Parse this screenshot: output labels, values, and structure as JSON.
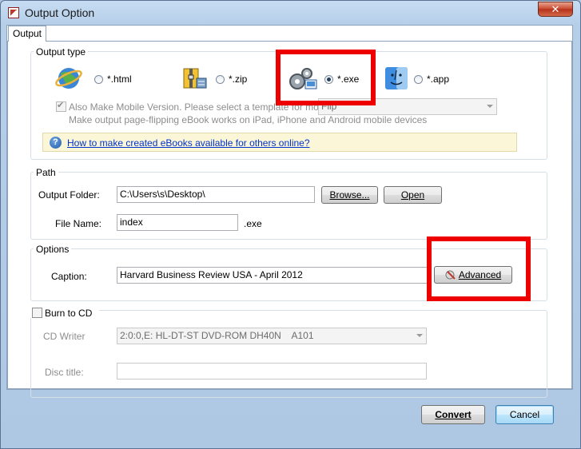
{
  "window": {
    "title": "Output Option",
    "close_label": "✕"
  },
  "tabs": {
    "output": "Output"
  },
  "output_type": {
    "label": "Output type",
    "html": "*.html",
    "zip": "*.zip",
    "exe": "*.exe",
    "app": "*.app",
    "selected": "exe",
    "mobile_label": "Also Make Mobile Version. Please select a template for mobile:",
    "mobile_template": "Flip",
    "mobile_desc": "Make output page-flipping eBook works on iPad, iPhone and Android mobile devices",
    "help_link": "How to make created eBooks available for others online?"
  },
  "path": {
    "label": "Path",
    "folder_label": "Output Folder:",
    "folder_value": "C:\\Users\\s\\Desktop\\",
    "browse": "Browse...",
    "open": "Open",
    "file_label": "File Name:",
    "file_value": "index",
    "ext": ".exe"
  },
  "options": {
    "label": "Options",
    "caption_label": "Caption:",
    "caption_value": "Harvard Business Review USA - April 2012",
    "advanced": "Advanced"
  },
  "burn": {
    "label": "Burn to CD",
    "writer_label": "CD Writer",
    "writer_value": "2:0:0,E: HL-DT-ST DVD-ROM DH40N    A101",
    "disc_label": "Disc title:",
    "disc_value": ""
  },
  "footer": {
    "convert": "Convert",
    "cancel": "Cancel"
  },
  "colors": {
    "highlight": "#ee0000",
    "link": "#0033cc",
    "infobar": "#fcf6d8"
  }
}
